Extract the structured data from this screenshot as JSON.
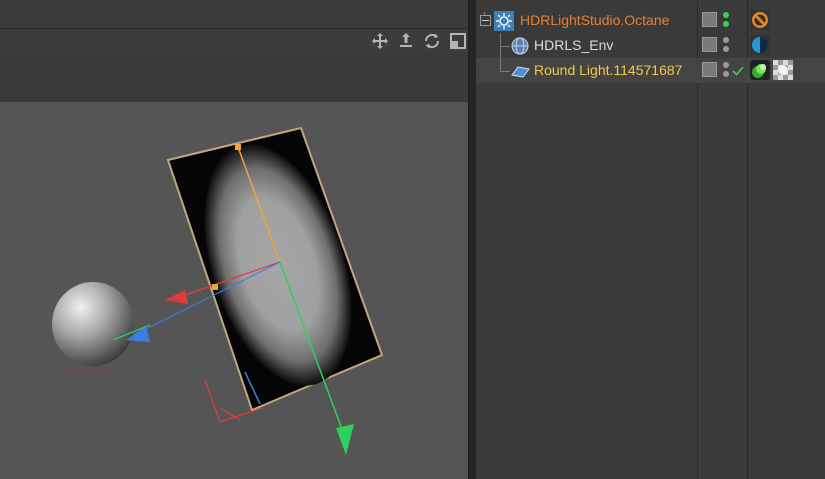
{
  "toolbar": {
    "icons": [
      "move-icon",
      "zoom-icon",
      "rotate-icon",
      "maximize-icon"
    ]
  },
  "object_manager": {
    "objects": [
      {
        "name": "HDRLightStudio.Octane",
        "icon": "hdr-light-studio-icon",
        "name_color": "#e2823a",
        "tags": [
          "octane-tag-icon"
        ]
      },
      {
        "name": "HDRLS_Env",
        "icon": "environment-sphere-icon",
        "name_color": "#dcdcdc",
        "tags": [
          "octane-environment-tag-icon"
        ]
      },
      {
        "name": "Round Light.114571687",
        "icon": "area-light-plane-icon",
        "name_color": "#f2c94c",
        "tags": [
          "octane-light-tag-icon",
          "texture-tag-icon"
        ]
      }
    ]
  },
  "colors": {
    "accent_orange": "#e2823a",
    "selected_yellow": "#f2c94c",
    "vis_green": "#3cd24c",
    "axis_x": "#e03c3c",
    "axis_y": "#2ed25a",
    "axis_z": "#3b7de0"
  }
}
